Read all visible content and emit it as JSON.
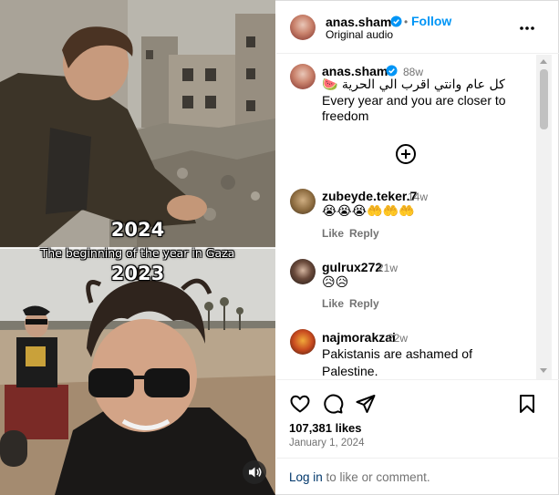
{
  "media": {
    "year_top": "2024",
    "caption": "The beginning of the year in Gaza",
    "year_bottom": "2023"
  },
  "header": {
    "username": "anas.sham0",
    "separator": "•",
    "follow_label": "Follow",
    "audio_label": "Original audio"
  },
  "post": {
    "username": "anas.sham0",
    "age": "88w",
    "caption_ar": "كل عام وانتي اقرب الي الحرية 🍉",
    "caption_en_1": "Every year and you are closer to",
    "caption_en_2": "freedom"
  },
  "comments": [
    {
      "username": "zubeyde.teker.7",
      "age": "14w",
      "text": "😭😭😭🤲🤲🤲",
      "like_label": "Like",
      "reply_label": "Reply"
    },
    {
      "username": "gulrux272",
      "age": "21w",
      "text": "😥😥",
      "like_label": "Like",
      "reply_label": "Reply"
    },
    {
      "username": "najmorakzai",
      "age": "22w",
      "text_1": "Pakistanis are ashamed of",
      "text_2": "Palestine."
    }
  ],
  "footer": {
    "likes": "107,381 likes",
    "date": "January 1, 2024",
    "login_link": "Log in",
    "login_rest": " to like or comment."
  },
  "colors": {
    "accent": "#0095f6",
    "secondary_text": "#737373",
    "link": "#00376b",
    "border": "#dbdbdb"
  }
}
